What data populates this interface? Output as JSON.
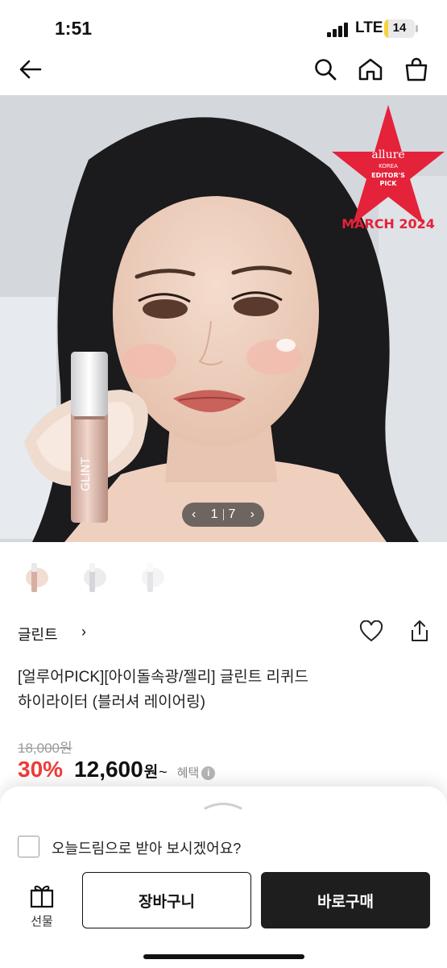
{
  "status_bar": {
    "time": "1:51",
    "network": "LTE",
    "battery": "14",
    "battery_level": 0.14
  },
  "nav": {
    "back_icon": "arrow-left-icon",
    "search_icon": "search-icon",
    "home_icon": "home-icon",
    "cart_icon": "shopping-bag-icon"
  },
  "hero": {
    "badge_brand": "allure",
    "badge_region": "KOREA",
    "badge_line1": "EDITOR'S",
    "badge_line2": "PICK",
    "badge_date": "MARCH 2024",
    "product_logo": "GLINT",
    "pager": {
      "current": "1",
      "total": "7",
      "prev": "‹",
      "next": "›"
    }
  },
  "thumbnails": [
    "blusher-layering",
    "variant-white",
    "variant-clear"
  ],
  "brand": {
    "name": "글린트",
    "chevron": "›"
  },
  "product": {
    "title_line1": "[얼루어PICK][아이돌속광/젤리] 글린트 리퀴드",
    "title_line2": "하이라이터 (블러셔 레이어링)",
    "original_price": "18,000원",
    "discount": "30%",
    "price": "12,600",
    "price_unit": "원",
    "tilde": "~",
    "benefit_label": "혜택",
    "info_icon": "i"
  },
  "sheet": {
    "dawn_delivery_label": "오늘드림으로 받아 보시겠어요?",
    "gift_label": "선물",
    "cart_button": "장바구니",
    "buy_button": "바로구매"
  },
  "colors": {
    "accent_red": "#ee3b39",
    "buy_button": "#1e1e1e",
    "badge_red": "#e4223a"
  }
}
